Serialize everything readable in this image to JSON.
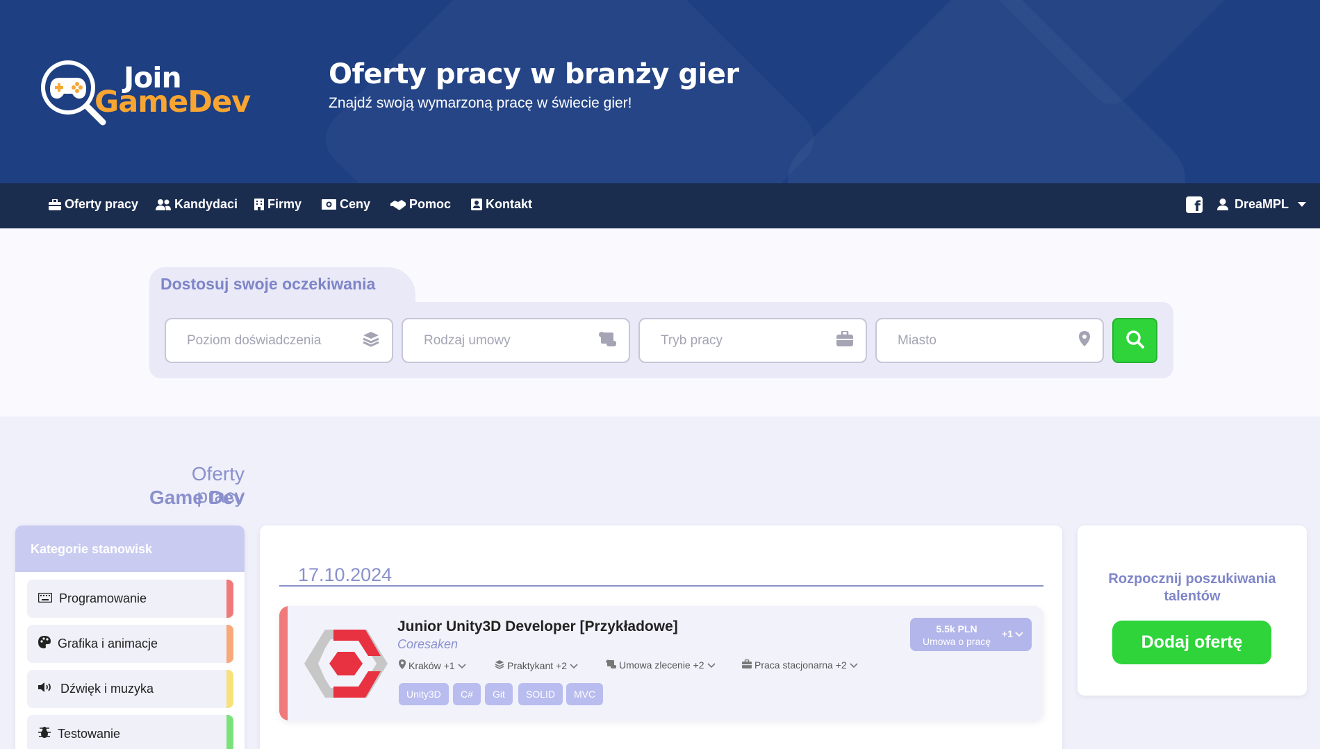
{
  "hero": {
    "logo_join": "Join",
    "logo_gamedev": "GameDev",
    "title": "Oferty pracy w branży gier",
    "subtitle": "Znajdź swoją wymarzoną pracę w świecie gier!"
  },
  "nav": {
    "items": [
      {
        "label": "Oferty pracy",
        "icon": "briefcase-icon"
      },
      {
        "label": "Kandydaci",
        "icon": "users-icon"
      },
      {
        "label": "Firmy",
        "icon": "building-icon"
      },
      {
        "label": "Ceny",
        "icon": "money-icon"
      },
      {
        "label": "Pomoc",
        "icon": "handshake-icon"
      },
      {
        "label": "Kontakt",
        "icon": "contact-card-icon"
      }
    ],
    "facebook_icon": "facebook-icon",
    "user": "DreaMPL"
  },
  "search": {
    "heading": "Dostosuj swoje oczekiwania",
    "fields": [
      {
        "placeholder": "Poziom doświadczenia",
        "icon": "layers-icon"
      },
      {
        "placeholder": "Rodzaj umowy",
        "icon": "scroll-icon"
      },
      {
        "placeholder": "Tryb pracy",
        "icon": "briefcase-icon"
      },
      {
        "placeholder": "Miasto",
        "icon": "map-pin-icon"
      }
    ],
    "button_icon": "search-icon"
  },
  "listing": {
    "title_line1": "Oferty pracy",
    "title_line2": "Game Dev"
  },
  "categories": {
    "header": "Kategorie stanowisk",
    "items": [
      {
        "label": "Programowanie",
        "icon": "keyboard-icon",
        "color": "#f07a7a"
      },
      {
        "label": "Grafika i animacje",
        "icon": "palette-icon",
        "color": "#f7a97a"
      },
      {
        "label": "Dźwięk i muzyka",
        "icon": "speaker-icon",
        "color": "#f7e27a"
      },
      {
        "label": "Testowanie",
        "icon": "bug-icon",
        "color": "#7ae27a"
      }
    ]
  },
  "jobs": {
    "date": "17.10.2024",
    "offer": {
      "title": "Junior Unity3D Developer [Przykładowe]",
      "company": "Coresaken",
      "salary": "5.5k PLN",
      "contract": "Umowa o pracę",
      "salary_more": "+1",
      "meta": [
        {
          "label": "Kraków +1",
          "icon": "map-pin-icon"
        },
        {
          "label": "Praktykant +2",
          "icon": "layers-icon"
        },
        {
          "label": "Umowa zlecenie +2",
          "icon": "scroll-icon"
        },
        {
          "label": "Praca stacjonarna +2",
          "icon": "briefcase-icon"
        }
      ],
      "tags": [
        "Unity3D",
        "C#",
        "Git",
        "SOLID",
        "MVC"
      ]
    }
  },
  "cta": {
    "text": "Rozpocznij poszukiwania talentów",
    "button": "Dodaj ofertę"
  },
  "colors": {
    "hero_bg": "#1e3f82",
    "nav_bg": "#1b2d4f",
    "accent_green": "#2ed43a",
    "accent_lavender": "#8a90cc",
    "logo_orange": "#f8a531"
  }
}
